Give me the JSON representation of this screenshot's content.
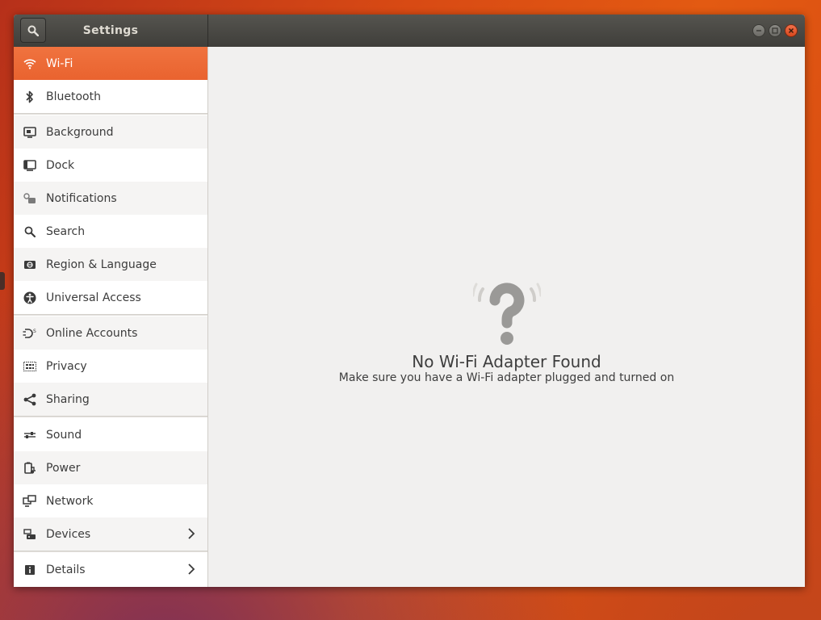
{
  "window": {
    "title": "Settings"
  },
  "colors": {
    "accent": "#E9632F",
    "titlebar": "#47463F",
    "close": "#E0521F"
  },
  "sidebar": {
    "items": [
      {
        "label": "Wi-Fi",
        "icon": "wifi-icon",
        "selected": true
      },
      {
        "label": "Bluetooth",
        "icon": "bluetooth-icon"
      },
      {
        "label": "Background",
        "icon": "background-icon"
      },
      {
        "label": "Dock",
        "icon": "dock-icon"
      },
      {
        "label": "Notifications",
        "icon": "notifications-icon"
      },
      {
        "label": "Search",
        "icon": "search-icon"
      },
      {
        "label": "Region & Language",
        "icon": "region-icon"
      },
      {
        "label": "Universal Access",
        "icon": "universal-access-icon"
      },
      {
        "label": "Online Accounts",
        "icon": "online-accounts-icon"
      },
      {
        "label": "Privacy",
        "icon": "privacy-icon"
      },
      {
        "label": "Sharing",
        "icon": "sharing-icon"
      },
      {
        "label": "Sound",
        "icon": "sound-icon"
      },
      {
        "label": "Power",
        "icon": "power-icon"
      },
      {
        "label": "Network",
        "icon": "network-icon"
      },
      {
        "label": "Devices",
        "icon": "devices-icon",
        "has_submenu": true
      },
      {
        "label": "Details",
        "icon": "details-icon",
        "has_submenu": true
      }
    ]
  },
  "main": {
    "empty_icon": "question-mark-icon",
    "title": "No Wi-Fi Adapter Found",
    "subtitle": "Make sure you have a Wi-Fi adapter plugged and turned on"
  }
}
